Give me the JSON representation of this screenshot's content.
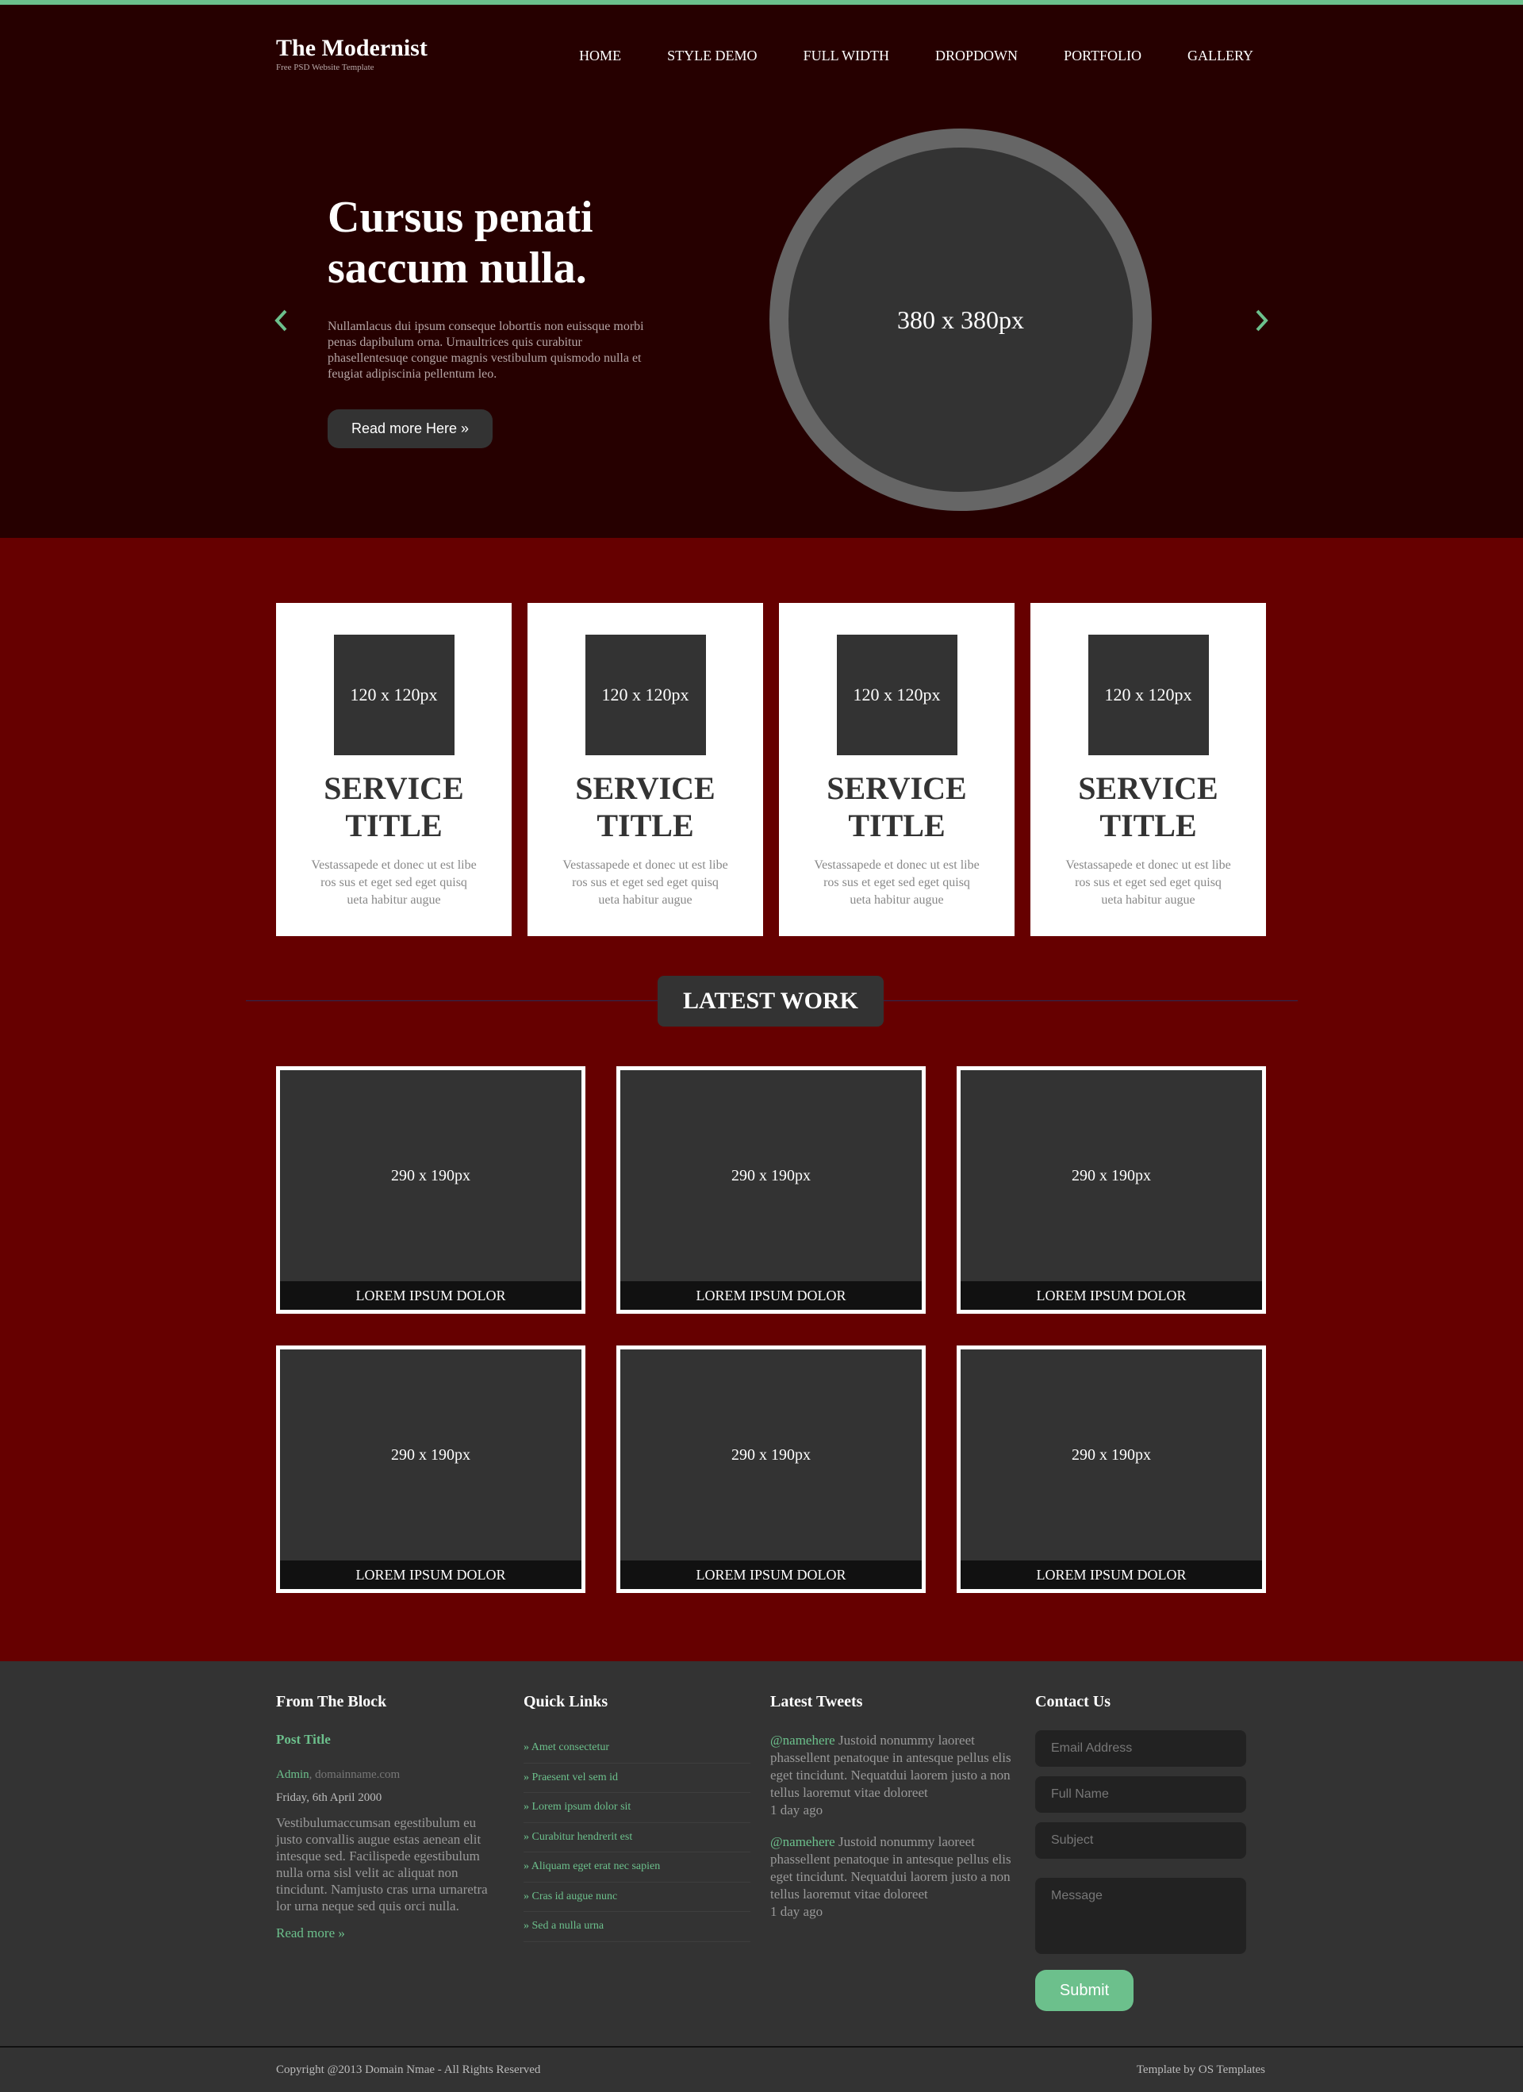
{
  "header": {
    "logo_title": "The Modernist",
    "logo_tagline": "Free PSD Website Template",
    "nav": [
      "HOME",
      "STYLE DEMO",
      "FULL WIDTH",
      "DROPDOWN",
      "PORTFOLIO",
      "GALLERY"
    ]
  },
  "hero": {
    "title": "Cursus penati saccum nulla.",
    "text": "Nullamlacus dui ipsum conseque loborttis non euissque morbi penas dapibulum orna. Urnaultrices quis curabitur phasellentesuqe congue magnis vestibulum quismodo nulla et feugiat adipiscinia pellentum leo.",
    "button": "Read more Here »",
    "image_label": "380 x 380px"
  },
  "services": [
    {
      "thumb": "120 x 120px",
      "title": "SERVICE TITLE",
      "text": "Vestassapede et donec ut est libe ros sus et eget sed eget quisq ueta habitur augue"
    },
    {
      "thumb": "120 x 120px",
      "title": "SERVICE TITLE",
      "text": "Vestassapede et donec ut est libe ros sus et eget sed eget quisq ueta habitur augue"
    },
    {
      "thumb": "120 x 120px",
      "title": "SERVICE TITLE",
      "text": "Vestassapede et donec ut est libe ros sus et eget sed eget quisq ueta habitur augue"
    },
    {
      "thumb": "120 x 120px",
      "title": "SERVICE TITLE",
      "text": "Vestassapede et donec ut est libe ros sus et eget sed eget quisq ueta habitur augue"
    }
  ],
  "latest_work": {
    "heading": "LATEST WORK",
    "items": [
      {
        "image": "290 x 190px",
        "caption": "LOREM IPSUM DOLOR"
      },
      {
        "image": "290 x 190px",
        "caption": "LOREM IPSUM DOLOR"
      },
      {
        "image": "290 x 190px",
        "caption": "LOREM IPSUM DOLOR"
      },
      {
        "image": "290 x 190px",
        "caption": "LOREM IPSUM DOLOR"
      },
      {
        "image": "290 x 190px",
        "caption": "LOREM IPSUM DOLOR"
      },
      {
        "image": "290 x 190px",
        "caption": "LOREM IPSUM DOLOR"
      }
    ]
  },
  "footer": {
    "block": {
      "heading": "From The Block",
      "post_title": "Post Title",
      "author": "Admin",
      "domain": "domainname.com",
      "date": "Friday, 6th April 2000",
      "body": "Vestibulumaccumsan egestibulum eu justo convallis augue estas aenean elit intesque sed. Facilispede egestibulum nulla orna sisl velit ac aliquat non tincidunt. Namjusto cras urna urnaretra lor urna neque sed quis orci nulla.",
      "read_more": "Read more »"
    },
    "links": {
      "heading": "Quick Links",
      "items": [
        "» Amet consectetur",
        "» Praesent vel sem id",
        "» Lorem ipsum dolor sit",
        "» Curabitur hendrerit est",
        "» Aliquam eget erat nec sapien",
        "» Cras id augue nunc",
        "» Sed a nulla urna"
      ]
    },
    "tweets": {
      "heading": "Latest Tweets",
      "items": [
        {
          "handle": "@namehere",
          "text": " Justoid nonummy laoreet phassellent penatoque in antesque pellus elis eget tincidunt. Nequatdui laorem justo a non tellus laoremut vitae doloreet",
          "time": "1 day ago"
        },
        {
          "handle": "@namehere",
          "text": " Justoid nonummy laoreet phassellent penatoque in antesque pellus elis eget tincidunt. Nequatdui laorem justo a non tellus laoremut vitae doloreet",
          "time": "1 day ago"
        }
      ]
    },
    "contact": {
      "heading": "Contact Us",
      "email_placeholder": "Email Address",
      "name_placeholder": "Full Name",
      "subject_placeholder": "Subject",
      "message_placeholder": "Message",
      "submit": "Submit"
    }
  },
  "copyright": {
    "left": "Copyright @2013 Domain Nmae - All Rights Reserved",
    "right": "Template by OS Templates"
  },
  "colors": {
    "accent": "#6cc08c",
    "header_bg": "#260000",
    "main_bg": "#660000",
    "footer_bg": "#333333"
  }
}
